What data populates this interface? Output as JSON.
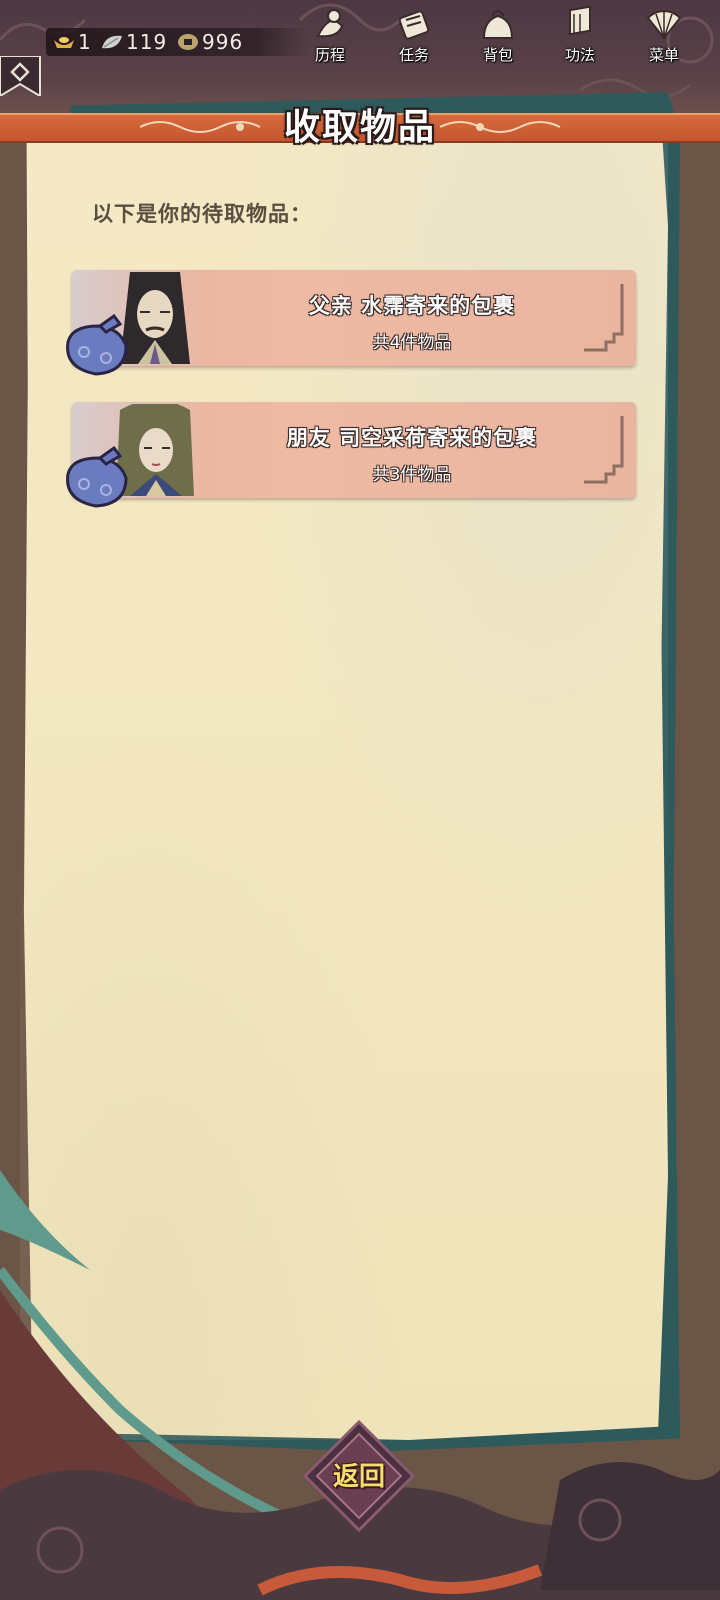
{
  "resources": [
    {
      "icon": "ingot-icon",
      "value": "1"
    },
    {
      "icon": "leaf-icon",
      "value": "119"
    },
    {
      "icon": "coin-icon",
      "value": "996"
    }
  ],
  "nav": [
    {
      "label": "历程",
      "icon": "journey-icon"
    },
    {
      "label": "任务",
      "icon": "task-icon"
    },
    {
      "label": "背包",
      "icon": "bag-icon"
    },
    {
      "label": "功法",
      "icon": "scroll-icon"
    },
    {
      "label": "菜单",
      "icon": "fan-icon"
    }
  ],
  "page": {
    "title": "收取物品",
    "prompt": "以下是你的待取物品："
  },
  "parcels": [
    {
      "sender": "父亲 水霈寄来的包裹",
      "count": "共4件物品"
    },
    {
      "sender": "朋友 司空采荷寄来的包裹",
      "count": "共3件物品"
    }
  ],
  "back_label": "返回",
  "colors": {
    "banner": "#c95b32",
    "paper": "#f3e8c1",
    "card": "#eab6a1",
    "frame": "#2f5a5b",
    "back_text": "#f6df6c"
  }
}
